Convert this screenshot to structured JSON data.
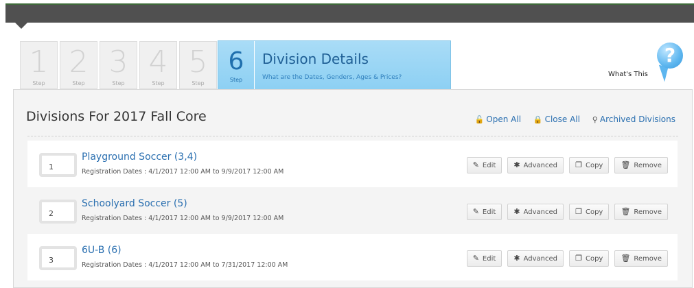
{
  "wizard": {
    "steps": [
      {
        "number": "1",
        "label": "Step"
      },
      {
        "number": "2",
        "label": "Step"
      },
      {
        "number": "3",
        "label": "Step"
      },
      {
        "number": "4",
        "label": "Step"
      },
      {
        "number": "5",
        "label": "Step"
      }
    ],
    "active": {
      "number": "6",
      "label": "Step",
      "title": "Division Details",
      "subtitle": "What are the Dates, Genders, Ages & Prices?"
    }
  },
  "help": {
    "label": "What's This",
    "icon": "question-icon",
    "glyph": "?"
  },
  "panel": {
    "title": "Divisions For 2017 Fall Core",
    "actions": [
      {
        "label": "Open All",
        "icon": "unlock-icon",
        "glyph": "🔓"
      },
      {
        "label": "Close All",
        "icon": "lock-icon",
        "glyph": "🔒"
      },
      {
        "label": "Archived Divisions",
        "icon": "search-icon",
        "glyph": "⚲"
      }
    ]
  },
  "divisions": [
    {
      "index": "1",
      "name": "Playground Soccer (3,4)",
      "dates": "Registration Dates : 4/1/2017 12:00 AM to 9/9/2017 12:00 AM"
    },
    {
      "index": "2",
      "name": "Schoolyard Soccer (5)",
      "dates": "Registration Dates : 4/1/2017 12:00 AM to 9/9/2017 12:00 AM"
    },
    {
      "index": "3",
      "name": "6U-B (6)",
      "dates": "Registration Dates : 4/1/2017 12:00 AM to 7/31/2017 12:00 AM"
    }
  ],
  "row_buttons": {
    "edit": {
      "label": "Edit",
      "icon": "pencil-icon",
      "glyph": "✎"
    },
    "advanced": {
      "label": "Advanced",
      "icon": "gear-icon",
      "glyph": "✱"
    },
    "copy": {
      "label": "Copy",
      "icon": "copy-icon",
      "glyph": "❐"
    },
    "remove": {
      "label": "Remove",
      "icon": "trash-icon",
      "glyph": "🗑"
    }
  }
}
